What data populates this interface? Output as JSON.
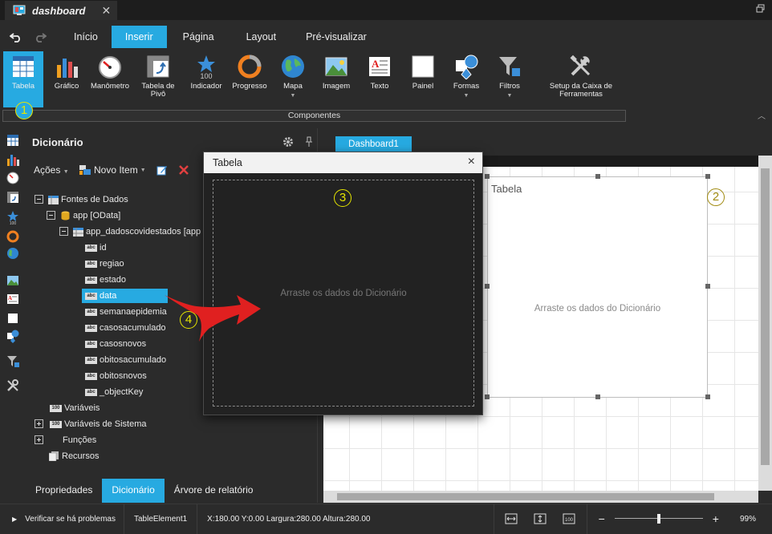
{
  "titlebar": {
    "doc_title": "dashboard",
    "close": "✕"
  },
  "menu": {
    "tabs": [
      "Início",
      "Inserir",
      "Página",
      "Layout",
      "Pré-visualizar"
    ],
    "active": "Inserir"
  },
  "ribbon": {
    "items": [
      {
        "label": "Tabela",
        "icon": "table-icon"
      },
      {
        "label": "Gráfico",
        "icon": "bar-chart-icon"
      },
      {
        "label": "Manômetro",
        "icon": "gauge-icon"
      },
      {
        "label": "Tabela de Pivô",
        "icon": "pivot-table-icon"
      },
      {
        "label": "Indicador",
        "icon": "indicator-icon",
        "sub": "100"
      },
      {
        "label": "Progresso",
        "icon": "progress-ring-icon"
      },
      {
        "label": "Mapa",
        "icon": "globe-icon"
      },
      {
        "label": "Imagem",
        "icon": "image-icon"
      },
      {
        "label": "Texto",
        "icon": "text-icon"
      },
      {
        "label": "Painel",
        "icon": "panel-icon"
      },
      {
        "label": "Formas",
        "icon": "shapes-icon"
      },
      {
        "label": "Filtros",
        "icon": "filter-icon"
      },
      {
        "label": "Setup da Caixa de Ferramentas",
        "icon": "tools-icon"
      }
    ],
    "group_label": "Componentes"
  },
  "markers": [
    "1",
    "2",
    "3",
    "4"
  ],
  "dictionary": {
    "title": "Dicionário",
    "actions_label": "Ações",
    "new_item_label": "Novo Item",
    "tree": {
      "datasources": "Fontes de Dados",
      "app": "app [OData]",
      "source": "app_dadoscovidestados [app",
      "fields": [
        "id",
        "regiao",
        "estado",
        "data",
        "semanaepidemia",
        "casosacumulado",
        "casosnovos",
        "obitosacumulado",
        "obitosnovos",
        "_objectKey"
      ],
      "selected_field": "data",
      "variables": "Variáveis",
      "system_variables": "Variáveis de Sistema",
      "functions": "Funções",
      "resources": "Recursos"
    },
    "field_badge": "abc",
    "var_badge": "100"
  },
  "bottom_tabs": [
    "Propriedades",
    "Dicionário",
    "Árvore de relatório"
  ],
  "bottom_active": "Dicionário",
  "dashboard": {
    "tab_label": "Dashboard1"
  },
  "table_element": {
    "title": "Tabela",
    "hint": "Arraste os dados do Dicionário"
  },
  "dialog": {
    "title": "Tabela",
    "hint": "Arraste os dados do Dicionário"
  },
  "status": {
    "check": "Verificar se há problemas",
    "element": "TableElement1",
    "geometry": "X:180.00 Y:0.00 Largura:280.00 Altura:280.00",
    "zoom_minus": "−",
    "zoom_plus": "+",
    "zoom": "99%",
    "zoom_level": 0.5
  },
  "colors": {
    "accent": "#27aae1",
    "marker": "#e6e600",
    "arrow": "#e02020"
  }
}
